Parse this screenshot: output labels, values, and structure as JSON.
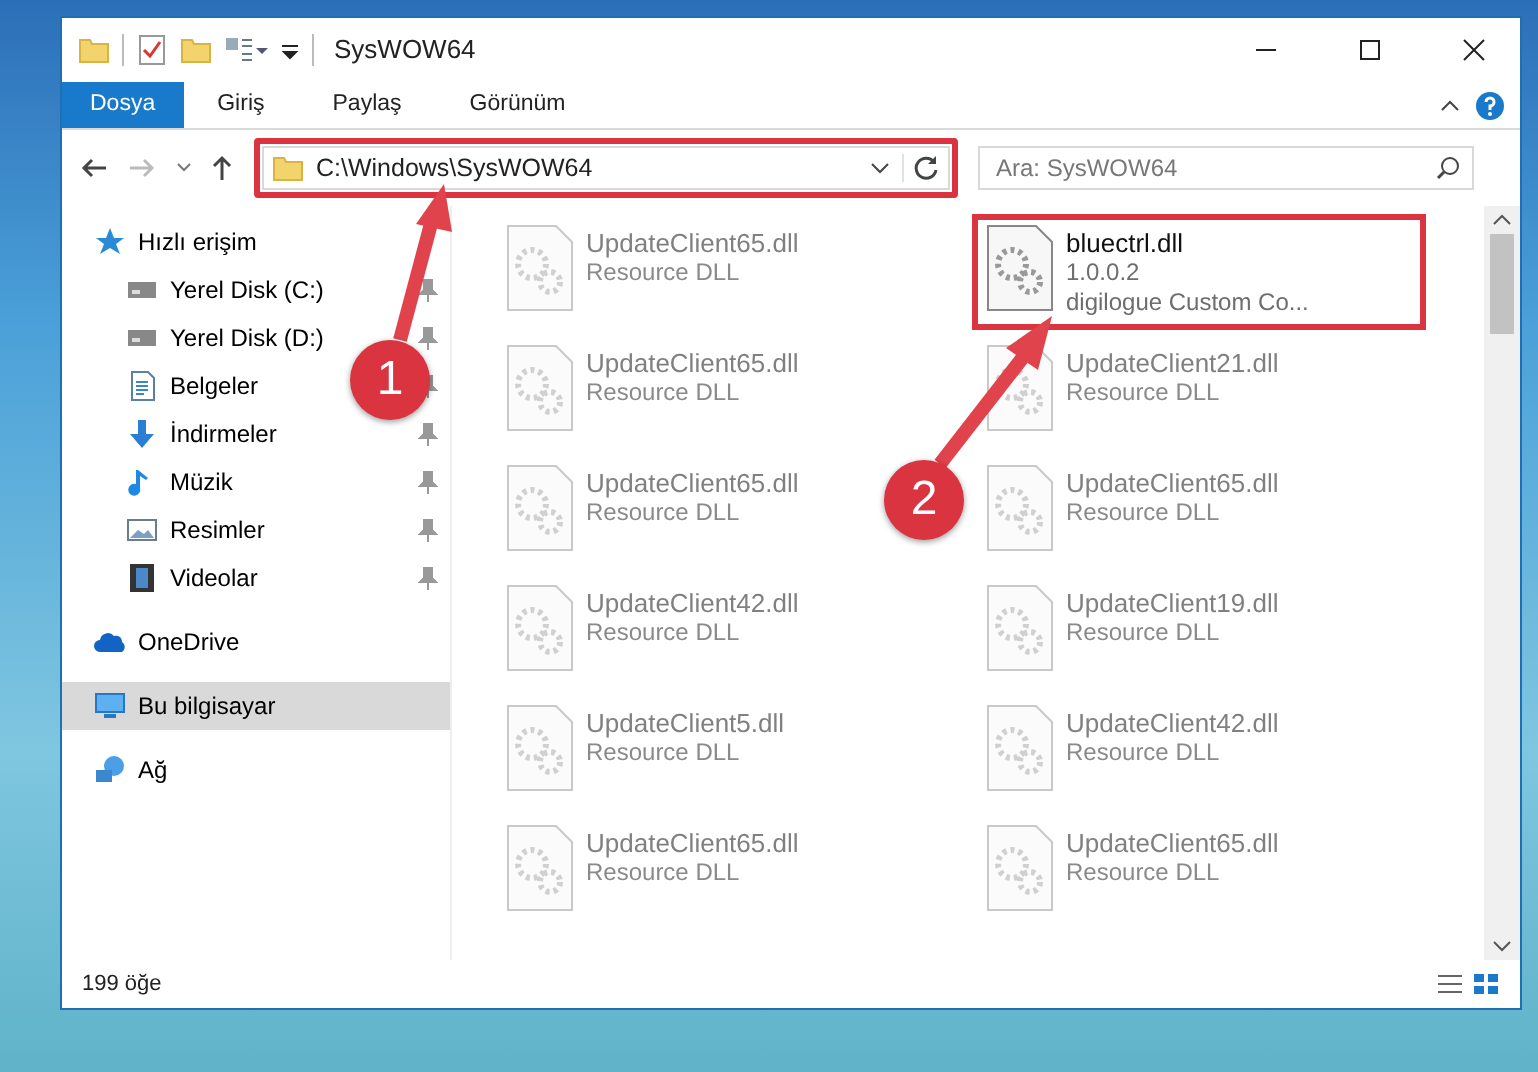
{
  "window": {
    "title": "SysWOW64"
  },
  "ribbon_tabs": [
    {
      "label": "Dosya",
      "selected": true
    },
    {
      "label": "Giriş",
      "selected": false
    },
    {
      "label": "Paylaş",
      "selected": false
    },
    {
      "label": "Görünüm",
      "selected": false
    }
  ],
  "address": {
    "path": "C:\\Windows\\SysWOW64",
    "highlighted": true
  },
  "search": {
    "placeholder": "Ara: SysWOW64"
  },
  "sidebar": {
    "items": [
      {
        "label": "Hızlı erişim",
        "kind": "star",
        "selected": false,
        "children": [
          {
            "label": "Yerel Disk (C:)",
            "kind": "drive",
            "pinned": true,
            "selected": false
          },
          {
            "label": "Yerel Disk (D:)",
            "kind": "drive",
            "pinned": true,
            "selected": false
          },
          {
            "label": "Belgeler",
            "kind": "document",
            "pinned": true,
            "selected": false
          },
          {
            "label": "İndirmeler",
            "kind": "download",
            "pinned": true,
            "selected": false
          },
          {
            "label": "Müzik",
            "kind": "music",
            "pinned": true,
            "selected": false
          },
          {
            "label": "Resimler",
            "kind": "pictures",
            "pinned": true,
            "selected": false
          },
          {
            "label": "Videolar",
            "kind": "video",
            "pinned": true,
            "selected": false
          }
        ]
      },
      {
        "label": "OneDrive",
        "kind": "cloud",
        "selected": false
      },
      {
        "label": "Bu bilgisayar",
        "kind": "computer",
        "selected": true
      },
      {
        "label": "Ağ",
        "kind": "network",
        "selected": false
      }
    ]
  },
  "files": [
    {
      "name": "UpdateClient65.dll",
      "lines": [
        "Resource DLL"
      ],
      "dimmed": true,
      "highlighted": false
    },
    {
      "name": "bluectrl.dll",
      "lines": [
        "1.0.0.2",
        "digilogue Custom Co..."
      ],
      "dimmed": false,
      "highlighted": true
    },
    {
      "name": "UpdateClient65.dll",
      "lines": [
        "Resource DLL"
      ],
      "dimmed": true,
      "highlighted": false
    },
    {
      "name": "UpdateClient21.dll",
      "lines": [
        "Resource DLL"
      ],
      "dimmed": true,
      "highlighted": false
    },
    {
      "name": "UpdateClient65.dll",
      "lines": [
        "Resource DLL"
      ],
      "dimmed": true,
      "highlighted": false
    },
    {
      "name": "UpdateClient65.dll",
      "lines": [
        "Resource DLL"
      ],
      "dimmed": true,
      "highlighted": false
    },
    {
      "name": "UpdateClient42.dll",
      "lines": [
        "Resource DLL"
      ],
      "dimmed": true,
      "highlighted": false
    },
    {
      "name": "UpdateClient19.dll",
      "lines": [
        "Resource DLL"
      ],
      "dimmed": true,
      "highlighted": false
    },
    {
      "name": "UpdateClient5.dll",
      "lines": [
        "Resource DLL"
      ],
      "dimmed": true,
      "highlighted": false
    },
    {
      "name": "UpdateClient42.dll",
      "lines": [
        "Resource DLL"
      ],
      "dimmed": true,
      "highlighted": false
    },
    {
      "name": "UpdateClient65.dll",
      "lines": [
        "Resource DLL"
      ],
      "dimmed": true,
      "highlighted": false
    },
    {
      "name": "UpdateClient65.dll",
      "lines": [
        "Resource DLL"
      ],
      "dimmed": true,
      "highlighted": false
    }
  ],
  "annotations": [
    {
      "label": "1"
    },
    {
      "label": "2"
    }
  ],
  "status_bar": {
    "item_count": "199 öğe"
  }
}
